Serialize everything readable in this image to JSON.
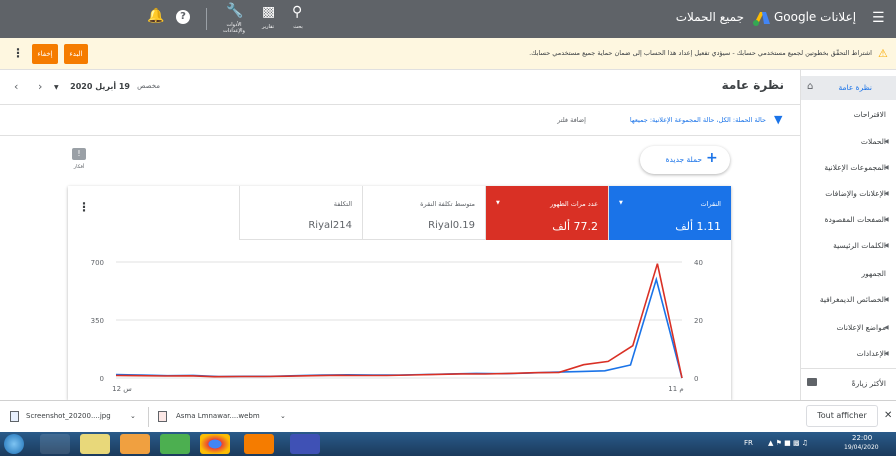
{
  "topbar": {
    "product": "Google إعلانات",
    "page_title": "جميع الحملات",
    "search_label": "بحث",
    "reports_label": "تقارير",
    "tools_label": "الأدوات والإعدادات"
  },
  "notice": {
    "text": "اشتراط التحقّق بخطوتين لجميع مستخدمي حسابك - سيؤدي تفعيل إعداد هذا الحساب إلى ضمان حماية جميع مستخدمي حسابك.",
    "start_label": "البدء",
    "dismiss_label": "إخفاء"
  },
  "header": {
    "title": "نظرة عامة",
    "date_label": "مخصص",
    "date_value": "19 أبريل 2020"
  },
  "filters": {
    "text": "حالة الحملة: الكل، حالة المجموعة الإعلانية: جميعها",
    "add": "إضافة فلتر"
  },
  "ideas_label": "أفكار",
  "new_campaign": "حملة جديدة",
  "sidebar": {
    "items": [
      {
        "label": "نظرة عامة"
      },
      {
        "label": "الاقتراحات"
      },
      {
        "label": "الحملات"
      },
      {
        "label": "المجموعات الإعلانية"
      },
      {
        "label": "الإعلانات والإضافات"
      },
      {
        "label": "الصفحات المقصودة"
      },
      {
        "label": "الكلمات الرئيسية"
      },
      {
        "label": "الجمهور"
      },
      {
        "label": "الخصائص الديمغرافية"
      },
      {
        "label": "مواضع الإعلانات"
      },
      {
        "label": "الإعدادات"
      },
      {
        "label": "الأكثر زيارةً"
      }
    ]
  },
  "metrics": [
    {
      "title": "النقرات",
      "value": "1.11 ألف",
      "color": "#1a73e8"
    },
    {
      "title": "عدد مرات الظهور",
      "value": "77.2 ألف",
      "color": "#d93025"
    },
    {
      "title": "متوسط تكلفة النقرة",
      "value": "Riyal0.19",
      "color": "#ffffff"
    },
    {
      "title": "التكلفة",
      "value": "Riyal214",
      "color": "#ffffff"
    }
  ],
  "chart_data": {
    "type": "line",
    "x_ticks": [
      "12 س",
      "11 م"
    ],
    "left_axis": {
      "ticks": [
        "0",
        "350",
        "700"
      ],
      "ylim": [
        0,
        700
      ]
    },
    "right_axis": {
      "ticks": [
        "0",
        "20",
        "40"
      ],
      "ylim": [
        0,
        40
      ]
    },
    "series": [
      {
        "color": "#1a73e8",
        "axis": "right",
        "values": [
          1.2,
          1.0,
          0.8,
          0.9,
          0.5,
          0.6,
          0.6,
          0.8,
          1.0,
          1.1,
          1.0,
          1.0,
          1.2,
          1.4,
          1.6,
          1.5,
          1.7,
          2.0,
          2.2,
          2.5,
          4.5,
          34,
          0
        ]
      },
      {
        "color": "#d93025",
        "axis": "left",
        "values": [
          15,
          14,
          12,
          13,
          8,
          9,
          9,
          11,
          14,
          16,
          15,
          15,
          18,
          22,
          25,
          24,
          28,
          32,
          34,
          80,
          100,
          195,
          690,
          0
        ]
      }
    ],
    "grid": true
  },
  "downloads": {
    "file1": "Screenshot_20200....jpg",
    "file2": "Asma Lmnawar....webm",
    "show_all": "Tout afficher"
  },
  "taskbar": {
    "lang": "FR",
    "time": "22:00",
    "date": "19/04/2020"
  }
}
